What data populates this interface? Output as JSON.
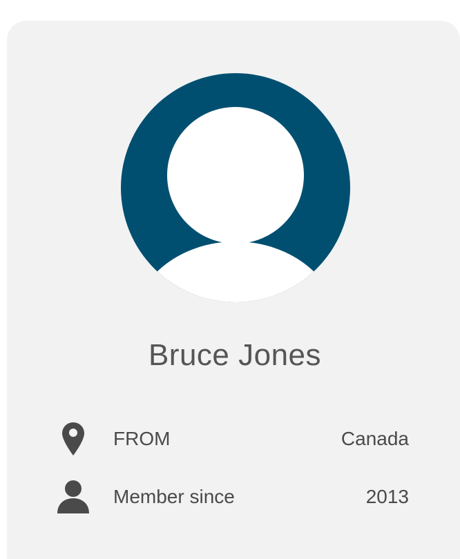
{
  "profile": {
    "name": "Bruce Jones",
    "avatar_icon": "user-silhouette-icon",
    "accent_color": "#004f71"
  },
  "details": {
    "from": {
      "icon": "location-pin-icon",
      "label": "FROM",
      "value": "Canada"
    },
    "member_since": {
      "icon": "person-icon",
      "label": "Member since",
      "value": "2013"
    }
  }
}
